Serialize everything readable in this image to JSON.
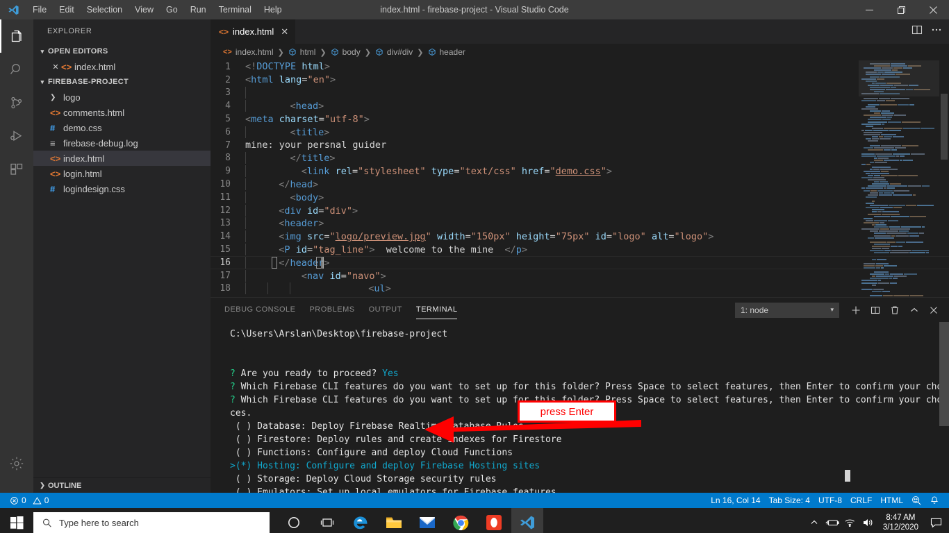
{
  "titlebar": {
    "title": "index.html - firebase-project - Visual Studio Code",
    "menus": [
      "File",
      "Edit",
      "Selection",
      "View",
      "Go",
      "Run",
      "Terminal",
      "Help"
    ],
    "minimize_label": "—",
    "maximize_label": "❐",
    "close_label": "✕"
  },
  "activitybar": {
    "items": [
      {
        "name": "explorer",
        "icon": "files-icon"
      },
      {
        "name": "search",
        "icon": "search-icon"
      },
      {
        "name": "source-control",
        "icon": "source-control-icon"
      },
      {
        "name": "run-debug",
        "icon": "run-and-debug-icon"
      },
      {
        "name": "extensions",
        "icon": "extensions-icon"
      }
    ],
    "settings_icon": "gear-icon"
  },
  "sidebar": {
    "title": "EXPLORER",
    "open_editors": {
      "label": "OPEN EDITORS",
      "items": [
        {
          "name": "index.html",
          "icon": "html-icon",
          "close": "✕"
        }
      ]
    },
    "project": {
      "label": "FIREBASE-PROJECT",
      "items": [
        {
          "name": "logo",
          "icon": "folder-chevron-icon",
          "type": "folder",
          "selected": false
        },
        {
          "name": "comments.html",
          "icon": "html-icon",
          "type": "html",
          "selected": false
        },
        {
          "name": "demo.css",
          "icon": "css-icon",
          "type": "css",
          "selected": false
        },
        {
          "name": "firebase-debug.log",
          "icon": "log-icon",
          "type": "log",
          "selected": false
        },
        {
          "name": "index.html",
          "icon": "html-icon",
          "type": "html",
          "selected": true
        },
        {
          "name": "login.html",
          "icon": "html-icon",
          "type": "html",
          "selected": false
        },
        {
          "name": "logindesign.css",
          "icon": "css-icon",
          "type": "css",
          "selected": false
        }
      ]
    },
    "outline_label": "OUTLINE"
  },
  "editor": {
    "tab": {
      "label": "index.html",
      "close": "✕"
    },
    "actions": [
      "split-editor-icon",
      "more-actions-icon"
    ],
    "breadcrumb": [
      "index.html",
      "html",
      "body",
      "div#div",
      "header"
    ],
    "lines": [
      {
        "n": 1,
        "html": "<span class='tk-br'>&lt;!</span><span class='tk-tag'>DOCTYPE</span> <span class='tk-attr' style='color:#9cdcfe'>html</span><span class='tk-br'>&gt;</span>",
        "indent": 0
      },
      {
        "n": 2,
        "html": "<span class='tk-br'>&lt;</span><span class='tk-tag'>html</span> <span class='tk-attr'>lang</span><span class='tk-eq'>=</span><span class='tk-str'>\"en\"</span><span class='tk-br'>&gt;</span>",
        "indent": 0
      },
      {
        "n": 3,
        "html": "",
        "indent": 1
      },
      {
        "n": 4,
        "html": "    <span class='tk-br'>&lt;</span><span class='tk-tag'>head</span><span class='tk-br'>&gt;</span>",
        "indent": 1
      },
      {
        "n": 5,
        "html": "<span class='tk-br'>&lt;</span><span class='tk-tag'>meta</span> <span class='tk-attr'>charset</span><span class='tk-eq'>=</span><span class='tk-str'>\"utf-8\"</span><span class='tk-br'>&gt;</span>",
        "indent": 0
      },
      {
        "n": 6,
        "html": "    <span class='tk-br'>&lt;</span><span class='tk-tag'>title</span><span class='tk-br'>&gt;</span>",
        "indent": 1
      },
      {
        "n": 7,
        "html": "<span class='tk-txt'>mine: your persnal guider</span>",
        "indent": 0
      },
      {
        "n": 8,
        "html": "    <span class='tk-br'>&lt;/</span><span class='tk-tag'>title</span><span class='tk-br'>&gt;</span>",
        "indent": 1
      },
      {
        "n": 9,
        "html": "      <span class='tk-br'>&lt;</span><span class='tk-tag'>link</span> <span class='tk-attr'>rel</span><span class='tk-eq'>=</span><span class='tk-str'>\"stylesheet\"</span> <span class='tk-attr'>type</span><span class='tk-eq'>=</span><span class='tk-str'>\"text/css\"</span> <span class='tk-attr'>href</span><span class='tk-eq'>=</span><span class='tk-str'>\"</span><span class='tk-link'>demo.css</span><span class='tk-str'>\"</span><span class='tk-br'>&gt;</span>",
        "indent": 1
      },
      {
        "n": 10,
        "html": "  <span class='tk-br'>&lt;/</span><span class='tk-tag'>head</span><span class='tk-br'>&gt;</span>",
        "indent": 1
      },
      {
        "n": 11,
        "html": "    <span class='tk-br'>&lt;</span><span class='tk-tag'>body</span><span class='tk-br'>&gt;</span>",
        "indent": 1
      },
      {
        "n": 12,
        "html": "  <span class='tk-br'>&lt;</span><span class='tk-tag'>div</span> <span class='tk-attr'>id</span><span class='tk-eq'>=</span><span class='tk-str'>\"div\"</span><span class='tk-br'>&gt;</span>",
        "indent": 1
      },
      {
        "n": 13,
        "html": "  <span class='tk-br'>&lt;</span><span class='tk-tag'>header</span><span class='tk-br'>&gt;</span>",
        "indent": 1
      },
      {
        "n": 14,
        "html": "  <span class='tk-br'>&lt;</span><span class='tk-tag'>img</span> <span class='tk-attr'>src</span><span class='tk-eq'>=</span><span class='tk-str'>\"</span><span class='tk-link'>logo/preview.jpg</span><span class='tk-str'>\"</span> <span class='tk-attr'>width</span><span class='tk-eq'>=</span><span class='tk-str'>\"150px\"</span> <span class='tk-attr'>height</span><span class='tk-eq'>=</span><span class='tk-str'>\"75px\"</span> <span class='tk-attr'>id</span><span class='tk-eq'>=</span><span class='tk-str'>\"logo\"</span> <span class='tk-attr'>alt</span><span class='tk-eq'>=</span><span class='tk-str'>\"logo\"</span><span class='tk-br'>&gt;</span>",
        "indent": 1
      },
      {
        "n": 15,
        "html": "  <span class='tk-br'>&lt;</span><span class='tk-tag'>P</span> <span class='tk-attr'>id</span><span class='tk-eq'>=</span><span class='tk-str'>\"tag_line\"</span><span class='tk-br'>&gt;</span><span class='tk-txt'>  welcome to the mine  </span><span class='tk-br'>&lt;/</span><span class='tk-tag'>p</span><span class='tk-br'>&gt;</span>",
        "indent": 1
      },
      {
        "n": 16,
        "html": "  <span class='tk-br'>&lt;/</span><span class='tk-tag'>header</span><span class='tk-br'>&gt;</span>",
        "indent": 1
      },
      {
        "n": 17,
        "html": "      <span class='tk-br'>&lt;</span><span class='tk-tag'>nav</span> <span class='tk-attr'>id</span><span class='tk-eq'>=</span><span class='tk-str'>\"navo\"</span><span class='tk-br'>&gt;</span>",
        "indent": 1
      },
      {
        "n": 18,
        "html": "          <span class='tk-br'>&lt;</span><span class='tk-tag'>ul</span><span class='tk-br'>&gt;</span>",
        "indent": 3
      }
    ],
    "cursor_line": 16
  },
  "panel": {
    "tabs": [
      {
        "label": "DEBUG CONSOLE",
        "active": false
      },
      {
        "label": "PROBLEMS",
        "active": false
      },
      {
        "label": "OUTPUT",
        "active": false
      },
      {
        "label": "TERMINAL",
        "active": true
      }
    ],
    "terminal_select": "1: node",
    "actions": [
      {
        "name": "new-terminal-button",
        "glyph": "+"
      },
      {
        "name": "split-terminal-button",
        "glyph": "◫"
      },
      {
        "name": "kill-terminal-button",
        "glyph": "🗑"
      },
      {
        "name": "maximize-panel-button",
        "glyph": "∧"
      },
      {
        "name": "close-panel-button",
        "glyph": "✕"
      }
    ]
  },
  "terminal": {
    "cwd": "C:\\Users\\Arslan\\Desktop\\firebase-project",
    "lines": [
      {
        "type": "prompt",
        "q": "?",
        "text": " Are you ready to proceed? ",
        "answer": "Yes"
      },
      {
        "type": "prompt",
        "q": "?",
        "text": " Which Firebase CLI features do you want to set up for this folder? Press Space to select features, then Enter to confirm your choi",
        "answer": ""
      },
      {
        "type": "prompt",
        "q": "?",
        "text": " Which Firebase CLI features do you want to set up for this folder? Press Space to select features, then Enter to confirm your choi",
        "answer": ""
      },
      {
        "type": "plain",
        "text": "ces."
      },
      {
        "type": "option",
        "marker": " ( ) ",
        "text": "Database: Deploy Firebase Realtime Database Rules",
        "selected": false
      },
      {
        "type": "option",
        "marker": " ( ) ",
        "text": "Firestore: Deploy rules and create indexes for Firestore",
        "selected": false
      },
      {
        "type": "option",
        "marker": " ( ) ",
        "text": "Functions: Configure and deploy Cloud Functions",
        "selected": false
      },
      {
        "type": "option",
        "marker": ">(*) ",
        "text": "Hosting: Configure and deploy Firebase Hosting sites",
        "selected": true
      },
      {
        "type": "option",
        "marker": " ( ) ",
        "text": "Storage: Deploy Cloud Storage security rules",
        "selected": false
      },
      {
        "type": "option",
        "marker": " ( ) ",
        "text": "Emulators: Set up local emulators for Firebase features",
        "selected": false
      }
    ]
  },
  "annotation": {
    "text": "press Enter",
    "box_color": "#ff0000",
    "text_color": "#ff0000",
    "bg_color": "#ffffff"
  },
  "statusbar": {
    "errors": "0",
    "warnings": "0",
    "position": "Ln 16, Col 14",
    "tab_size": "Tab Size: 4",
    "encoding": "UTF-8",
    "eol": "CRLF",
    "language": "HTML",
    "feedback_icon": "smiley-feedback-icon",
    "bell_icon": "bell-icon",
    "accent": "#007acc"
  },
  "taskbar": {
    "start_icon": "windows-start-icon",
    "search_placeholder": "Type here to search",
    "search_icon": "search-icon",
    "apps": [
      {
        "name": "cortana-icon",
        "active": false
      },
      {
        "name": "task-view-icon",
        "active": false
      },
      {
        "name": "microsoft-edge-icon",
        "active": false
      },
      {
        "name": "file-explorer-icon",
        "active": false
      },
      {
        "name": "mail-icon",
        "active": false
      },
      {
        "name": "google-chrome-icon",
        "active": false
      },
      {
        "name": "opera-icon",
        "active": false
      },
      {
        "name": "vscode-icon",
        "active": true
      }
    ],
    "tray": [
      {
        "name": "show-hidden-icons",
        "glyph": "∧"
      },
      {
        "name": "battery-icon",
        "glyph": "battery"
      },
      {
        "name": "wifi-icon",
        "glyph": "wifi"
      },
      {
        "name": "volume-icon",
        "glyph": "volume"
      }
    ],
    "time": "8:47 AM",
    "date": "3/12/2020",
    "notification_icon": "action-center-icon"
  }
}
